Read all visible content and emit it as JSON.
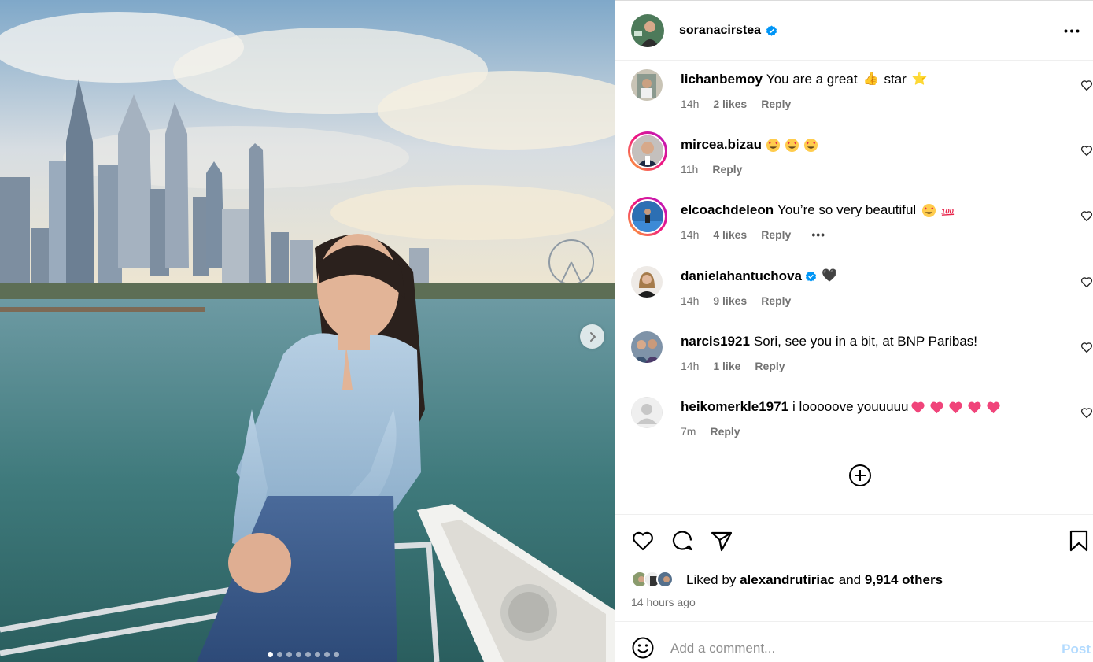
{
  "post": {
    "author": "soranacirstea",
    "author_verified": true,
    "carousel": {
      "total": 8,
      "current": 1
    }
  },
  "comments": [
    {
      "user": "lichanbemoy",
      "text": "You are a great",
      "emoji_a": "👍",
      "text_b": "star",
      "emoji_b": "⭐",
      "time": "14h",
      "likes": "2 likes",
      "reply": "Reply"
    },
    {
      "user": "mircea.bizau",
      "text": "",
      "emojis": [
        "heart-eyes",
        "heart-eyes",
        "heart-eyes"
      ],
      "time": "11h",
      "reply": "Reply"
    },
    {
      "user": "elcoachdeleon",
      "text": "You’re so very beautiful",
      "emojis": [
        "heart-eyes",
        "100"
      ],
      "time": "14h",
      "likes": "4 likes",
      "reply": "Reply",
      "more": "•••"
    },
    {
      "user": "danielahantuchova",
      "verified": true,
      "text": "",
      "emoji": "🖤",
      "time": "14h",
      "likes": "9 likes",
      "reply": "Reply"
    },
    {
      "user": "narcis1921",
      "text": "Sori, see you in a bit, at BNP Paribas!",
      "time": "14h",
      "likes": "1 like",
      "reply": "Reply"
    },
    {
      "user": "heikomerkle1971",
      "text": "i looooove youuuuu",
      "emojis": [
        "pink-heart",
        "pink-heart",
        "pink-heart",
        "pink-heart",
        "pink-heart"
      ],
      "time": "7m",
      "reply": "Reply"
    }
  ],
  "likes": {
    "prefix": "Liked by",
    "first_liker": "alexandrutiriac",
    "and": "and",
    "others": "9,914 others"
  },
  "posted_ago": "14 hours ago",
  "composer": {
    "placeholder": "Add a comment...",
    "post_label": "Post"
  },
  "icons": [
    "more-horizontal-icon",
    "heart-icon",
    "comment-icon",
    "share-icon",
    "bookmark-icon",
    "emoji-icon",
    "add-circle-icon",
    "chevron-right-icon",
    "verified-icon"
  ],
  "colors": {
    "verified": "#0095f6",
    "post_disabled": "#b3dbff",
    "meta_gray": "#737373",
    "heart_pink": "#f0447a"
  }
}
